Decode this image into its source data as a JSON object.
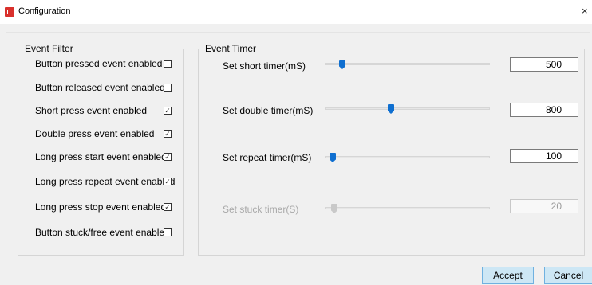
{
  "window": {
    "title": "Configuration",
    "close_symbol": "×",
    "app_icon": "app-icon",
    "accent_color": "#0f6fd0",
    "brand_color": "#d9302c"
  },
  "event_filter": {
    "legend": "Event Filter",
    "items": [
      {
        "label": "Button pressed event enabled",
        "checked": false,
        "mark": ""
      },
      {
        "label": "Button released event enabled",
        "checked": false,
        "mark": ""
      },
      {
        "label": "Short press event enabled",
        "checked": true,
        "mark": "✓"
      },
      {
        "label": "Double press event enabled",
        "checked": true,
        "mark": "✓"
      },
      {
        "label": "Long press start event enabled",
        "checked": true,
        "mark": "✓"
      },
      {
        "label": "Long press repeat event enabled",
        "checked": true,
        "mark": "✓"
      },
      {
        "label": "Long press stop event enabled",
        "checked": true,
        "mark": "✓"
      },
      {
        "label": "Button stuck/free event enabled",
        "checked": false,
        "mark": ""
      }
    ]
  },
  "event_timer": {
    "legend": "Event Timer",
    "timers": [
      {
        "label": "Set short timer(mS)",
        "value": "500",
        "slider_fraction": 0.1,
        "enabled": true
      },
      {
        "label": "Set double timer(mS)",
        "value": "800",
        "slider_fraction": 0.4,
        "enabled": true
      },
      {
        "label": "Set repeat timer(mS)",
        "value": "100",
        "slider_fraction": 0.02,
        "enabled": true
      },
      {
        "label": "Set stuck timer(S)",
        "value": "20",
        "slider_fraction": 0.04,
        "enabled": false
      }
    ]
  },
  "buttons": {
    "accept": "Accept",
    "cancel": "Cancel"
  }
}
